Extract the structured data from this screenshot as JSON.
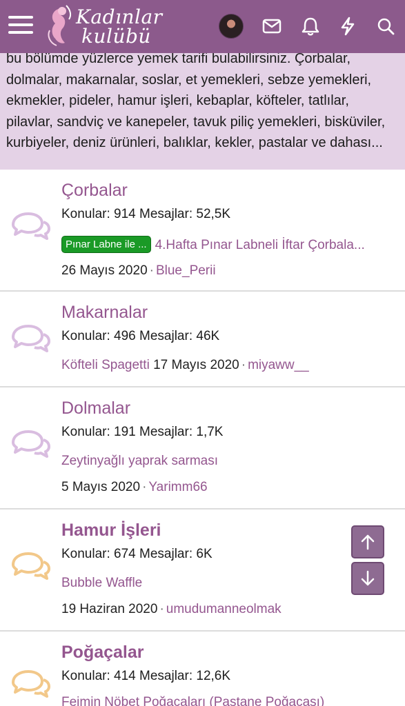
{
  "header": {
    "logo_line1": "Kadınlar",
    "logo_line2": "kulübü"
  },
  "intro_text": "bu bölümde yüzlerce yemek tarifi bulabilirsiniz. Çorbalar, dolmalar, makarnalar, soslar, et yemekleri, sebze yemekleri, ekmekler, pideler, hamur işleri, kebaplar, köfteler, tatlılar, pilavlar, sandviç ve kanepeler, tavuk piliç yemekleri, bisküviler, kurbiyeler, deniz ürünleri, balıklar, kekler, pastalar ve dahası...",
  "forums": [
    {
      "title": "Çorbalar",
      "stats": "Konular: 914 Mesajlar: 52,5K",
      "prefix": "Pınar Labne ile ...",
      "latest": "4.Hafta Pınar Labneli İftar Çorbala...",
      "date": "26 Mayıs 2020",
      "user": "Blue_Perii",
      "icon_color": "#d9bde0",
      "bold": false
    },
    {
      "title": "Makarnalar",
      "stats": "Konular: 496 Mesajlar: 46K",
      "latest": "Köfteli Spagetti",
      "date": "17 Mayıs 2020",
      "user": "miyaww__",
      "icon_color": "#d9bde0",
      "bold": false
    },
    {
      "title": "Dolmalar",
      "stats": "Konular: 191 Mesajlar: 1,7K",
      "latest": "Zeytinyağlı yaprak sarması",
      "date": "5 Mayıs 2020",
      "user": "Yarimm66",
      "icon_color": "#d9bde0",
      "bold": false
    },
    {
      "title": "Hamur İşleri",
      "stats": "Konular: 674 Mesajlar: 6K",
      "latest": "Bubble Waffle",
      "date": "19 Haziran 2020",
      "user": "umudumanneolmak",
      "icon_color": "#f2c88a",
      "bold": true
    },
    {
      "title": "Poğaçalar",
      "stats": "Konular: 414 Mesajlar: 12,6K",
      "latest": "Feimin Nöbet Poğaçaları (Pastane Poğaçası)",
      "icon_color": "#f2c88a",
      "bold": true
    }
  ],
  "colors": {
    "header_bg": "#8c5a8c",
    "accent": "#94568f",
    "prefix_green": "#1a9a26"
  }
}
